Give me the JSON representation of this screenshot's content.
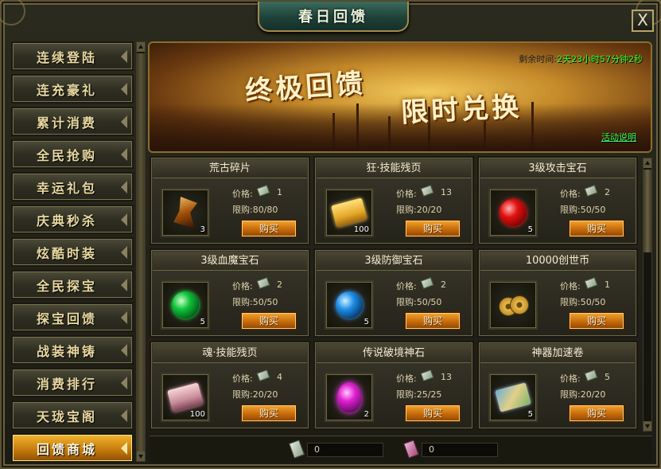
{
  "window": {
    "title": "春日回馈",
    "close_label": "X"
  },
  "sidebar": {
    "items": [
      {
        "label": "连续登陆",
        "active": false
      },
      {
        "label": "连充豪礼",
        "active": false
      },
      {
        "label": "累计消费",
        "active": false
      },
      {
        "label": "全民抢购",
        "active": false
      },
      {
        "label": "幸运礼包",
        "active": false
      },
      {
        "label": "庆典秒杀",
        "active": false
      },
      {
        "label": "炫酷时装",
        "active": false
      },
      {
        "label": "全民探宝",
        "active": false
      },
      {
        "label": "探宝回馈",
        "active": false
      },
      {
        "label": "战装神铸",
        "active": false
      },
      {
        "label": "消费排行",
        "active": false
      },
      {
        "label": "天珑宝阁",
        "active": false
      },
      {
        "label": "回馈商城",
        "active": true
      }
    ]
  },
  "banner": {
    "title_left": "终极回馈",
    "title_right": "限时兑换",
    "timer_label": "剩余时间:",
    "timer_value": "2天23小时57分钟2秒",
    "rules_link": "活动说明"
  },
  "shop": {
    "price_label": "价格:",
    "buy_label": "购买",
    "items": [
      {
        "name": "荒古碎片",
        "icon": "shard-icon",
        "qty": "3",
        "price": "1",
        "limit": "限购:80/80"
      },
      {
        "name": "狂·技能残页",
        "icon": "gold-scroll-icon",
        "qty": "100",
        "price": "13",
        "limit": "限购:20/20"
      },
      {
        "name": "3级攻击宝石",
        "icon": "red-gem-icon",
        "qty": "5",
        "price": "2",
        "limit": "限购:50/50"
      },
      {
        "name": "3级血魔宝石",
        "icon": "green-gem-icon",
        "qty": "5",
        "price": "2",
        "limit": "限购:50/50"
      },
      {
        "name": "3级防御宝石",
        "icon": "blue-gem-icon",
        "qty": "5",
        "price": "2",
        "limit": "限购:50/50"
      },
      {
        "name": "10000创世币",
        "icon": "coins-icon",
        "qty": "",
        "price": "1",
        "limit": "限购:50/50"
      },
      {
        "name": "魂·技能残页",
        "icon": "pink-scroll-icon",
        "qty": "100",
        "price": "4",
        "limit": "限购:20/20"
      },
      {
        "name": "传说破境神石",
        "icon": "purple-gem-icon",
        "qty": "2",
        "price": "13",
        "limit": "限购:25/25"
      },
      {
        "name": "神器加速卷",
        "icon": "map-scroll-icon",
        "qty": "5",
        "price": "5",
        "limit": "限购:20/20"
      }
    ]
  },
  "currency": {
    "silver_value": "0",
    "pink_value": "0"
  }
}
